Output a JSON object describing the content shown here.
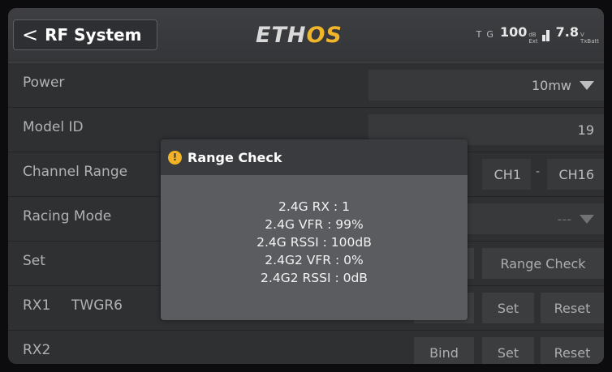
{
  "header": {
    "back_chevron": "<",
    "title": "RF System",
    "logo_eth": "ETH",
    "logo_os": "OS",
    "status": {
      "ext_ant_label": "T",
      "gps_label": "G",
      "rssi_value": "100",
      "rssi_unit": "dB",
      "rssi_sub": "Ext",
      "tx_voltage": "7.8",
      "tx_voltage_unit": "V",
      "tx_voltage_sub": "TxBatt"
    }
  },
  "rows": {
    "power": {
      "label": "Power",
      "value": "10mw"
    },
    "model_id": {
      "label": "Model ID",
      "value": "19"
    },
    "channel_range": {
      "label": "Channel Range",
      "start": "CH1",
      "separator": "-",
      "end": "CH16"
    },
    "racing_mode": {
      "label": "Racing Mode",
      "value": "---"
    },
    "set": {
      "label": "Set",
      "range_check": "Range Check"
    },
    "rx1": {
      "label": "RX1",
      "receiver": "TWGR6",
      "set": "Set",
      "reset": "Reset"
    },
    "rx2": {
      "label": "RX2",
      "bind": "Bind",
      "set": "Set",
      "reset": "Reset"
    }
  },
  "modal": {
    "icon": "warning-icon",
    "title": "Range Check",
    "lines": [
      "2.4G RX : 1",
      "2.4G VFR : 99%",
      "2.4G RSSI : 100dB",
      "2.4G2 VFR : 0%",
      "2.4G2 RSSI : 0dB"
    ]
  },
  "colors": {
    "background": "#3a3b3d",
    "accent": "#f0b52a",
    "modal_body": "#5b5c5f"
  }
}
